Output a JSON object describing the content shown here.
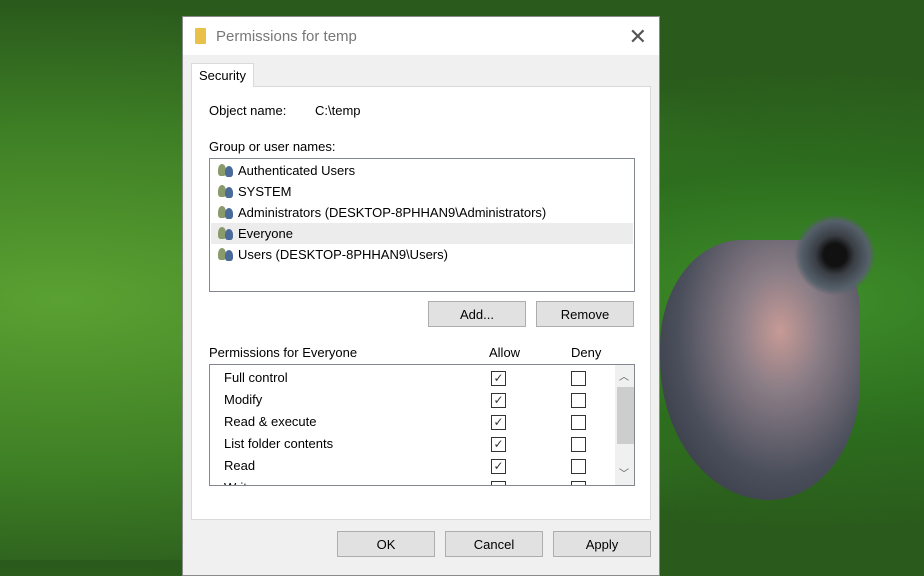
{
  "window": {
    "title": "Permissions for temp",
    "close": "✕"
  },
  "tab": "Security",
  "object": {
    "label": "Object name:",
    "value": "C:\\temp"
  },
  "group_label": "Group or user names:",
  "users": [
    {
      "name": "Authenticated Users",
      "selected": false
    },
    {
      "name": "SYSTEM",
      "selected": false
    },
    {
      "name": "Administrators (DESKTOP-8PHHAN9\\Administrators)",
      "selected": false
    },
    {
      "name": "Everyone",
      "selected": true
    },
    {
      "name": "Users (DESKTOP-8PHHAN9\\Users)",
      "selected": false
    }
  ],
  "buttons": {
    "add": "Add...",
    "remove": "Remove",
    "ok": "OK",
    "cancel": "Cancel",
    "apply": "Apply"
  },
  "permissions": {
    "header": "Permissions for Everyone",
    "allow": "Allow",
    "deny": "Deny",
    "rows": [
      {
        "name": "Full control",
        "allow": true,
        "deny": false
      },
      {
        "name": "Modify",
        "allow": true,
        "deny": false
      },
      {
        "name": "Read & execute",
        "allow": true,
        "deny": false
      },
      {
        "name": "List folder contents",
        "allow": true,
        "deny": false
      },
      {
        "name": "Read",
        "allow": true,
        "deny": false
      },
      {
        "name": "Write",
        "allow": false,
        "deny": false
      }
    ]
  }
}
